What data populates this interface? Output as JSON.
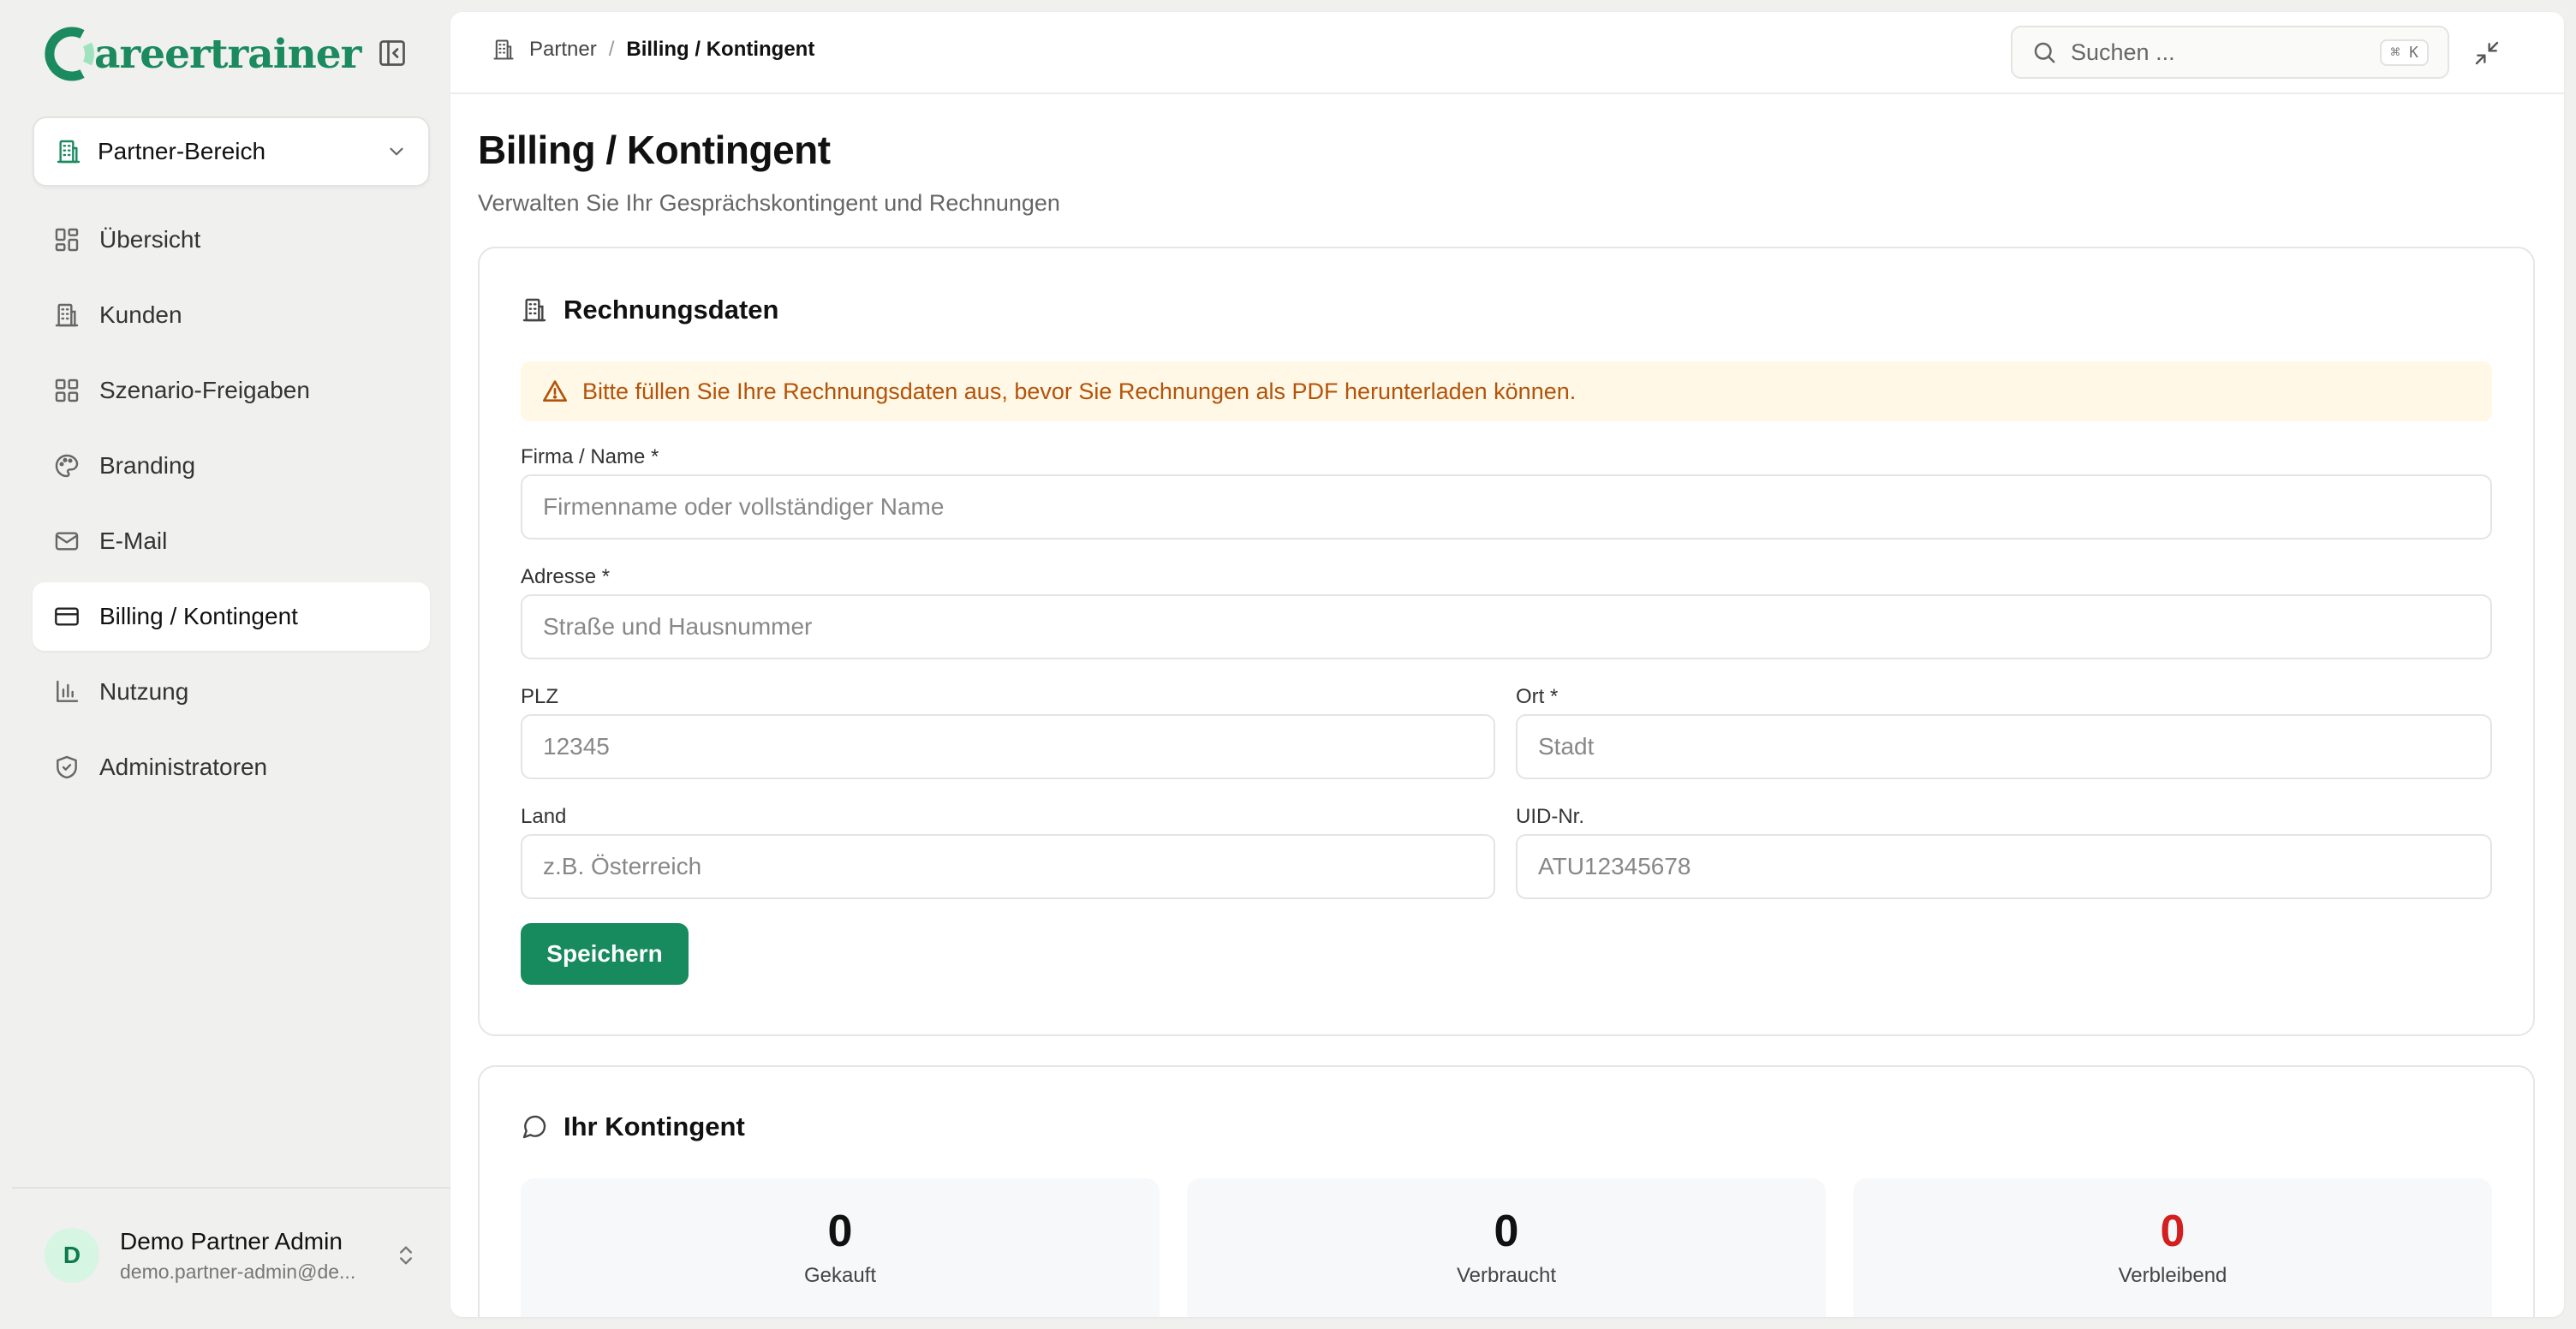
{
  "brand": {
    "name": "areertrainer",
    "color": "#1b8a5f"
  },
  "workspace": {
    "label": "Partner-Bereich"
  },
  "sidebar": {
    "items": [
      {
        "label": "Übersicht",
        "icon": "layout-grid-icon"
      },
      {
        "label": "Kunden",
        "icon": "building-icon"
      },
      {
        "label": "Szenario-Freigaben",
        "icon": "layout-grid-icon"
      },
      {
        "label": "Branding",
        "icon": "palette-icon"
      },
      {
        "label": "E-Mail",
        "icon": "mail-icon"
      },
      {
        "label": "Billing / Kontingent",
        "icon": "credit-card-icon",
        "active": true
      },
      {
        "label": "Nutzung",
        "icon": "bar-chart-icon"
      },
      {
        "label": "Administratoren",
        "icon": "shield-check-icon"
      }
    ]
  },
  "user": {
    "initial": "D",
    "name": "Demo Partner Admin",
    "email": "demo.partner-admin@de..."
  },
  "topbar": {
    "breadcrumb": {
      "parent": "Partner",
      "separator": "/",
      "current": "Billing / Kontingent"
    },
    "search": {
      "placeholder": "Suchen ...",
      "shortcut": "⌘ K"
    }
  },
  "page": {
    "title": "Billing / Kontingent",
    "subtitle": "Verwalten Sie Ihr Gesprächskontingent und Rechnungen"
  },
  "billing_form": {
    "title": "Rechnungsdaten",
    "alert": "Bitte füllen Sie Ihre Rechnungsdaten aus, bevor Sie Rechnungen als PDF herunterladen können.",
    "fields": {
      "company": {
        "label": "Firma / Name *",
        "placeholder": "Firmenname oder vollständiger Name",
        "value": ""
      },
      "address": {
        "label": "Adresse *",
        "placeholder": "Straße und Hausnummer",
        "value": ""
      },
      "zip": {
        "label": "PLZ",
        "placeholder": "12345",
        "value": ""
      },
      "city": {
        "label": "Ort *",
        "placeholder": "Stadt",
        "value": ""
      },
      "country": {
        "label": "Land",
        "placeholder": "z.B. Österreich",
        "value": ""
      },
      "vat": {
        "label": "UID-Nr.",
        "placeholder": "ATU12345678",
        "value": ""
      }
    },
    "save_label": "Speichern"
  },
  "quota": {
    "title": "Ihr Kontingent",
    "stats": [
      {
        "value": "0",
        "label": "Gekauft"
      },
      {
        "value": "0",
        "label": "Verbraucht"
      },
      {
        "value": "0",
        "label": "Verbleibend",
        "color": "#d21f1f"
      }
    ]
  },
  "colors": {
    "accent": "#178a5e",
    "warning_bg": "#fff8e6",
    "warning_text": "#b45309",
    "danger": "#d21f1f"
  }
}
